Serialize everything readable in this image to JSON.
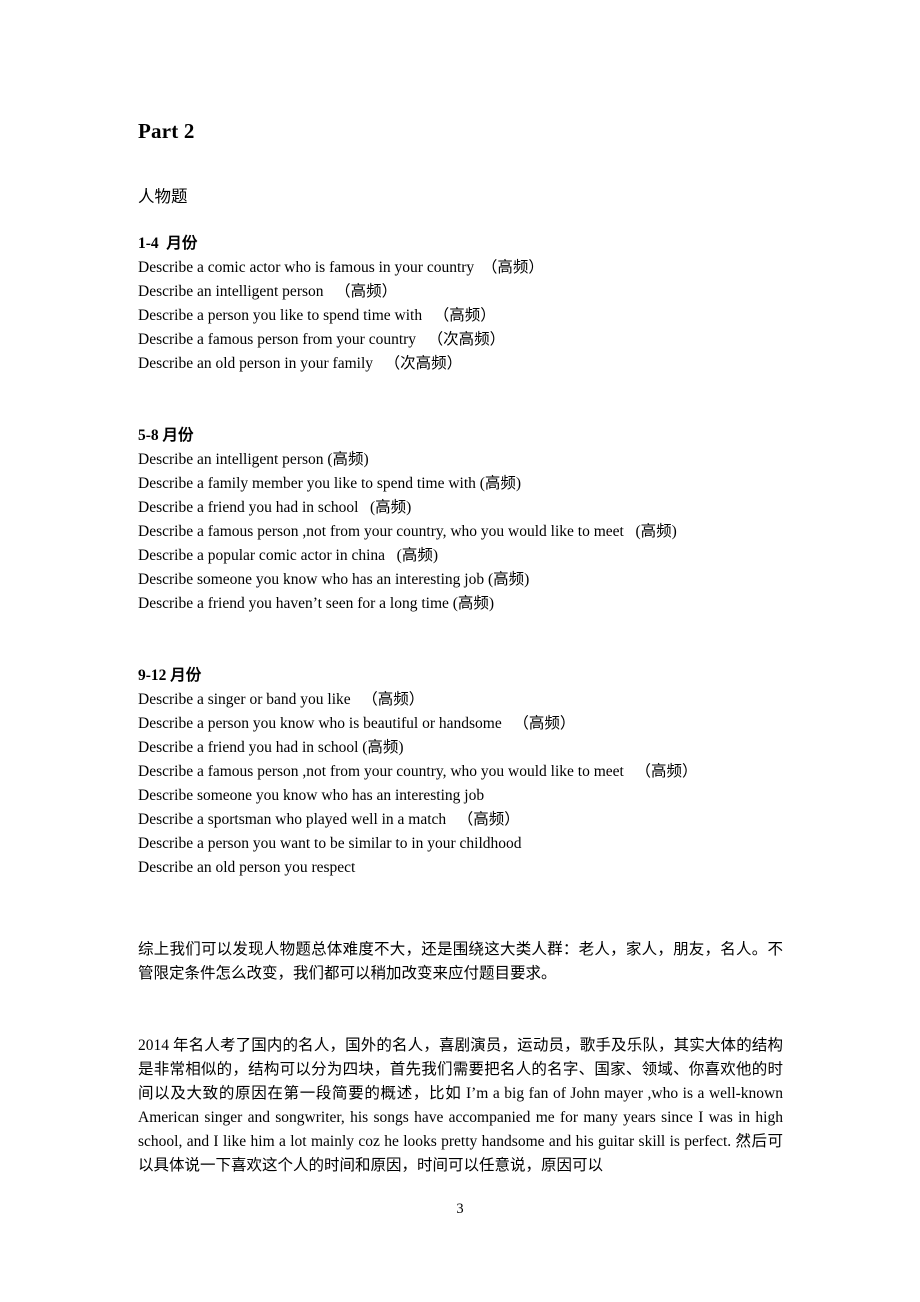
{
  "document": {
    "part_title": "Part 2",
    "topic_title": "人物题",
    "page_number": "3"
  },
  "sections": [
    {
      "heading": "1-4  月份",
      "items": [
        "Describe a comic actor who is famous in your country  （高频）",
        "Describe an intelligent person   （高频）",
        "Describe a person you like to spend time with   （高频）",
        "Describe a famous person from your country   （次高频）",
        "Describe an old person in your family   （次高频）"
      ]
    },
    {
      "heading": "5-8 月份",
      "items": [
        "Describe an intelligent person (高频)",
        "Describe a family member you like to spend time with (高频)",
        "Describe a friend you had in school   (高频)",
        "Describe a famous person ,not from your country, who you would like to meet   (高频)",
        "Describe a popular comic actor in china   (高频)",
        "Describe someone you know who has an interesting job (高频)",
        "Describe a friend you haven’t seen for a long time (高频)"
      ]
    },
    {
      "heading": "9-12 月份",
      "items": [
        "Describe a singer or band you like   （高频）",
        "Describe a person you know who is beautiful or handsome   （高频）",
        "Describe a friend you had in school (高频)",
        "Describe a famous person ,not from your country, who you would like to meet   （高频）",
        "Describe someone you know who has an interesting job",
        "Describe a sportsman who played well in a match   （高频）",
        "Describe a person you want to be similar to in your childhood",
        "Describe an old person you respect"
      ]
    }
  ],
  "paragraphs": {
    "summary": "综上我们可以发现人物题总体难度不大，还是围绕这大类人群：老人，家人，朋友，名人。不管限定条件怎么改变，我们都可以稍加改变来应付题目要求。",
    "body": "2014 年名人考了国内的名人，国外的名人，喜剧演员，运动员，歌手及乐队，其实大体的结构是非常相似的，结构可以分为四块，首先我们需要把名人的名字、国家、领域、你喜欢他的时间以及大致的原因在第一段简要的概述，比如 I’m a big fan of John mayer ,who is a well-known American singer and songwriter, his songs have accompanied me for many years since I was in high school, and I like him a lot mainly coz he looks pretty handsome and his guitar skill is perfect. 然后可以具体说一下喜欢这个人的时间和原因，时间可以任意说，原因可以"
  }
}
